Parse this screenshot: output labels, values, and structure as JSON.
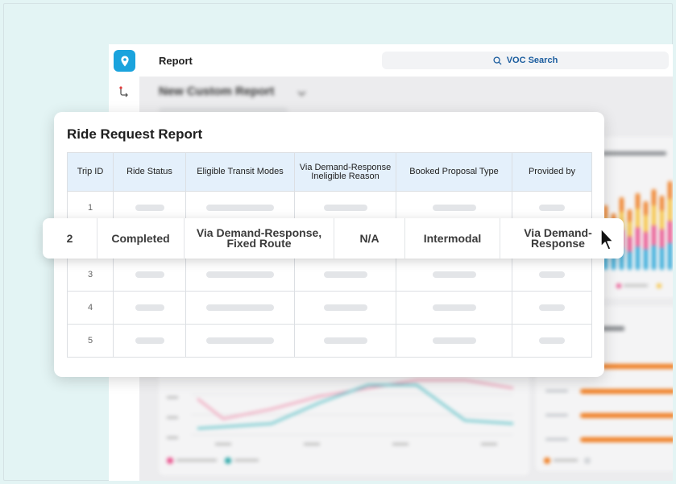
{
  "app": {
    "title": "Report",
    "search_label": "VOC Search",
    "brand_color": "#1aa3dd",
    "background_heading": "New Custom Report"
  },
  "report": {
    "title": "Ride Request Report",
    "columns": [
      "Trip ID",
      "Ride Status",
      "Eligible Transit Modes",
      "Via Demand-Response Ineligible Reason",
      "Booked Proposal Type",
      "Provided by"
    ],
    "row_ids": [
      "1",
      "3",
      "4",
      "5"
    ],
    "highlighted_row": {
      "trip_id": "2",
      "ride_status": "Completed",
      "eligible_transit_modes": "Via Demand-Response, Fixed Route",
      "ineligible_reason": "N/A",
      "booked_proposal_type": "Intermodal",
      "provided_by": "Via Demand-Response"
    }
  },
  "colors": {
    "accent_orange": "#f07c1e",
    "line_pink": "#f0a0b8",
    "line_teal": "#5cc2c8",
    "header_blue": "#e4f0fb"
  }
}
